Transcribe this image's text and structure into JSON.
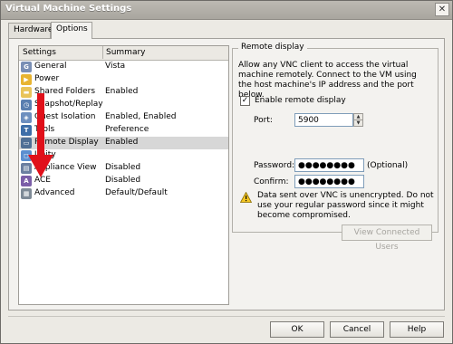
{
  "window": {
    "title": "Virtual Machine Settings",
    "close_label": "✕"
  },
  "tabs": [
    {
      "label": "Hardware",
      "active": false
    },
    {
      "label": "Options",
      "active": true
    }
  ],
  "settings_list": {
    "columns": [
      "Settings",
      "Summary"
    ],
    "rows": [
      {
        "label": "General",
        "summary": "Vista",
        "icon": "general-icon",
        "icon_color": "#7a8fb5"
      },
      {
        "label": "Power",
        "summary": "",
        "icon": "power-icon",
        "icon_color": "#e8b431"
      },
      {
        "label": "Shared Folders",
        "summary": "Enabled",
        "icon": "folder-icon",
        "icon_color": "#e9c45a"
      },
      {
        "label": "Snapshot/Replay",
        "summary": "",
        "icon": "snapshot-icon",
        "icon_color": "#5a7fb0"
      },
      {
        "label": "Guest Isolation",
        "summary": "Enabled, Enabled",
        "icon": "guest-isolation-icon",
        "icon_color": "#6d8fbf"
      },
      {
        "label": "Tools",
        "summary": "Preference",
        "icon": "tools-icon",
        "icon_color": "#3e6ea8"
      },
      {
        "label": "Remote Display",
        "summary": "Enabled",
        "icon": "remote-display-icon",
        "icon_color": "#4f6f95",
        "selected": true
      },
      {
        "label": "Unity",
        "summary": "",
        "icon": "unity-icon",
        "icon_color": "#5b8fd0"
      },
      {
        "label": "Appliance View",
        "summary": "Disabled",
        "icon": "appliance-view-icon",
        "icon_color": "#6b7fa0"
      },
      {
        "label": "ACE",
        "summary": "Disabled",
        "icon": "ace-icon",
        "icon_color": "#7b5ea8"
      },
      {
        "label": "Advanced",
        "summary": "Default/Default",
        "icon": "advanced-icon",
        "icon_color": "#7e8a96"
      }
    ]
  },
  "remote_display": {
    "group_title": "Remote display",
    "description": "Allow any VNC client to access the virtual machine remotely. Connect to the VM using the host machine's IP address and the port below.",
    "enable_label": "Enable remote display",
    "enable_checked": true,
    "port_label": "Port:",
    "port_value": "5900",
    "password_label": "Password:",
    "password_value": "●●●●●●●●",
    "optional_label": "(Optional)",
    "confirm_label": "Confirm:",
    "confirm_value": "●●●●●●●●",
    "warning_text": "Data sent over VNC is unencrypted. Do not use your regular password since it might become compromised.",
    "view_users_label": "View Connected Users"
  },
  "footer": {
    "ok_label": "OK",
    "cancel_label": "Cancel",
    "help_label": "Help"
  },
  "colors": {
    "selection": "#d7d7d7",
    "annotation_arrow": "#e0101a",
    "warning": "#f3c623"
  }
}
